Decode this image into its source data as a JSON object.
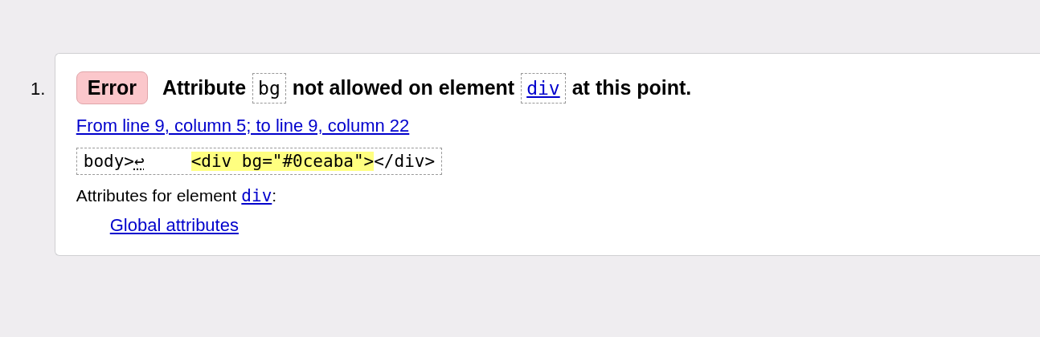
{
  "messages": [
    {
      "number": "1.",
      "badge": "Error",
      "text": [
        {
          "kind": "text",
          "text": "Attribute"
        },
        {
          "kind": "code",
          "text": "bg"
        },
        {
          "kind": "text",
          "text": "not allowed on element"
        },
        {
          "kind": "code-link",
          "text": "div"
        },
        {
          "kind": "text",
          "text": "at this point."
        }
      ],
      "location": "From line 9, column 5; to line 9, column 22",
      "extract": {
        "before": "body>",
        "linebreak": "↩",
        "highlight": "<div bg=\"#0ceaba\">",
        "after": "</div>"
      },
      "attributes_label": "Attributes for element",
      "attributes_element": "div",
      "attributes_colon": ":",
      "attribute_links": [
        "Global attributes"
      ]
    }
  ]
}
